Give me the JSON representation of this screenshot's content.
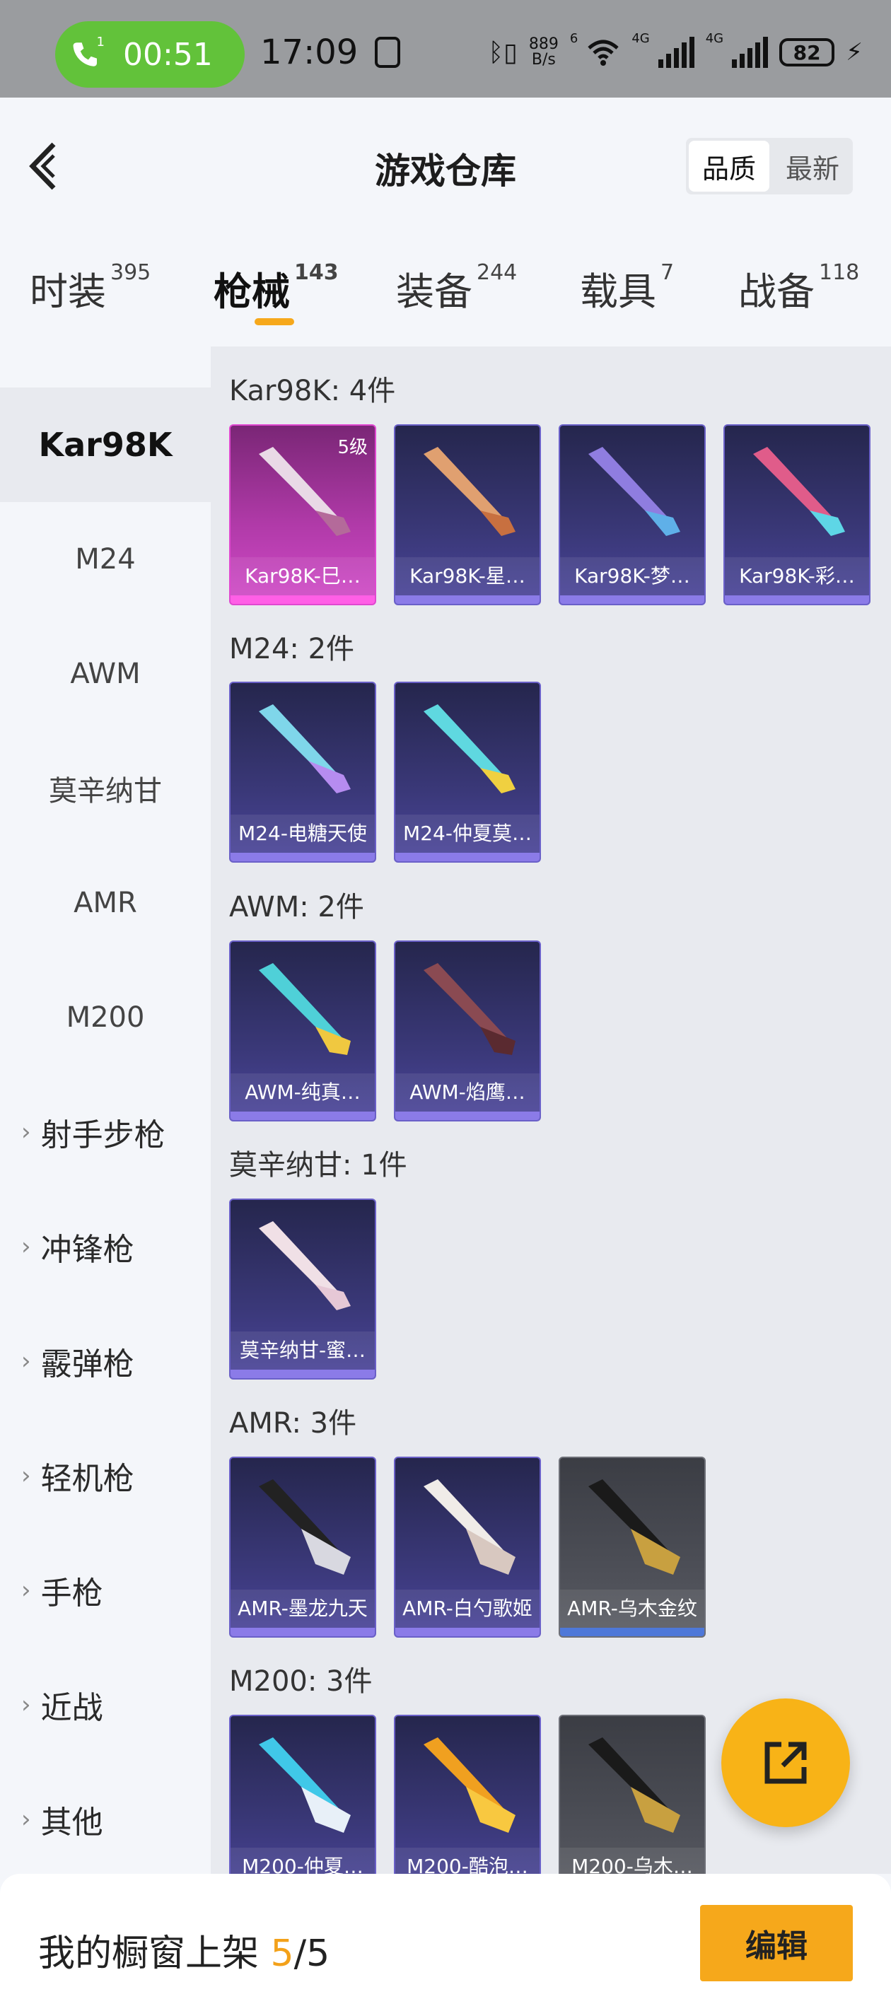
{
  "status_bar": {
    "call_timer": "00:51",
    "call_badge": "1",
    "clock": "17:09",
    "net_speed_top": "889",
    "net_speed_bottom": "B/s",
    "wifi_badge": "6",
    "signal1_label": "4G",
    "signal2_label": "4G",
    "battery": "82"
  },
  "header": {
    "title": "游戏仓库",
    "sort_quality": "品质",
    "sort_newest": "最新"
  },
  "tabs": [
    {
      "label": "时装",
      "count": "395"
    },
    {
      "label": "枪械",
      "count": "143"
    },
    {
      "label": "装备",
      "count": "244"
    },
    {
      "label": "载具",
      "count": "7"
    },
    {
      "label": "战备",
      "count": "118"
    }
  ],
  "sidebar": {
    "items": [
      {
        "label": "Kar98K"
      },
      {
        "label": "M24"
      },
      {
        "label": "AWM"
      },
      {
        "label": "莫辛纳甘"
      },
      {
        "label": "AMR"
      },
      {
        "label": "M200"
      },
      {
        "label": "射手步枪"
      },
      {
        "label": "冲锋枪"
      },
      {
        "label": "霰弹枪"
      },
      {
        "label": "轻机枪"
      },
      {
        "label": "手枪"
      },
      {
        "label": "近战"
      },
      {
        "label": "其他"
      }
    ]
  },
  "sections": [
    {
      "title": "Kar98K: 4件",
      "items": [
        {
          "name": "Kar98K-巳…",
          "level": "5级"
        },
        {
          "name": "Kar98K-星…"
        },
        {
          "name": "Kar98K-梦…"
        },
        {
          "name": "Kar98K-彩…"
        }
      ]
    },
    {
      "title": "M24: 2件",
      "items": [
        {
          "name": "M24-电糖天使"
        },
        {
          "name": "M24-仲夏莫…"
        }
      ]
    },
    {
      "title": "AWM: 2件",
      "items": [
        {
          "name": "AWM-纯真…"
        },
        {
          "name": "AWM-焰鹰…"
        }
      ]
    },
    {
      "title": "莫辛纳甘: 1件",
      "items": [
        {
          "name": "莫辛纳甘-蜜…"
        }
      ]
    },
    {
      "title": "AMR: 3件",
      "items": [
        {
          "name": "AMR-墨龙九天"
        },
        {
          "name": "AMR-白勺歌姬"
        },
        {
          "name": "AMR-乌木金纹"
        }
      ]
    },
    {
      "title": "M200: 3件",
      "items": [
        {
          "name": "M200-仲夏…"
        },
        {
          "name": "M200-酷泡…"
        },
        {
          "name": "M200-乌木…"
        }
      ]
    }
  ],
  "footer": {
    "label": "我的橱窗上架",
    "shown": "5",
    "separator": "/",
    "total": "5",
    "edit_label": "编辑"
  }
}
